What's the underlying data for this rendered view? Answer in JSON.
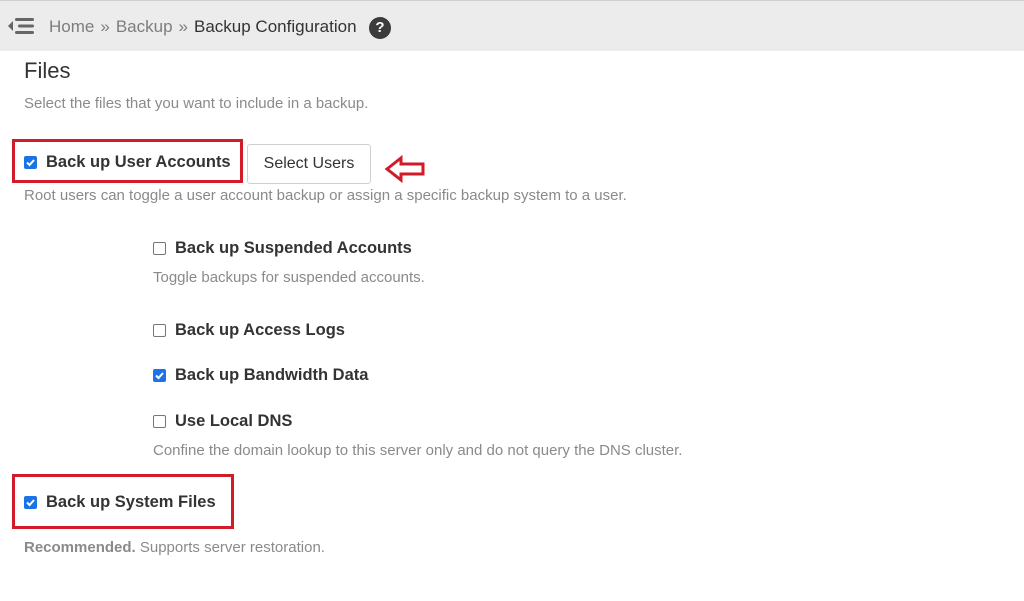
{
  "breadcrumb": {
    "home": "Home",
    "separator": "»",
    "backup": "Backup",
    "current": "Backup Configuration",
    "help_glyph": "?"
  },
  "files": {
    "title": "Files",
    "description": "Select the files that you want to include in a backup."
  },
  "options": {
    "user_accounts": {
      "label": "Back up User Accounts",
      "checked": true
    },
    "select_users_button": "Select Users",
    "user_accounts_help": "Root users can toggle a user account backup or assign a specific backup system to a user.",
    "suspended": {
      "label": "Back up Suspended Accounts",
      "checked": false
    },
    "suspended_help": "Toggle backups for suspended accounts.",
    "access_logs": {
      "label": "Back up Access Logs",
      "checked": false
    },
    "bandwidth": {
      "label": "Back up Bandwidth Data",
      "checked": true
    },
    "local_dns": {
      "label": "Use Local DNS",
      "checked": false
    },
    "local_dns_help": "Confine the domain lookup to this server only and do not query the DNS cluster.",
    "system_files": {
      "label": "Back up System Files",
      "checked": true
    },
    "system_files_help_strong": "Recommended.",
    "system_files_help": " Supports server restoration."
  },
  "colors": {
    "highlight": "#d11a2a",
    "checkbox": "#1a73e8",
    "topbar": "#ececec"
  },
  "icons": {
    "menu_toggle": "menu-collapse-icon",
    "help": "question-circle-icon",
    "annotation": "left-arrow-icon"
  }
}
